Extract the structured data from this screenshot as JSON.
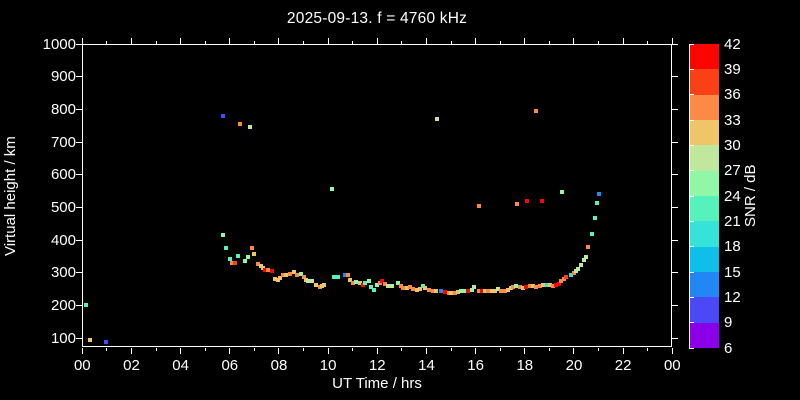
{
  "title": "2025-09-13. f = 4760 kHz",
  "colors": {
    "background": "#000000",
    "foreground": "#ffffff"
  },
  "chart_data": {
    "type": "scatter",
    "title": "2025-09-13. f = 4760 kHz",
    "xlabel": "UT Time / hrs",
    "ylabel": "Virtual height / km",
    "xlim": [
      0,
      24
    ],
    "xtick_hours": [
      0,
      2,
      4,
      6,
      8,
      10,
      12,
      14,
      16,
      18,
      20,
      22,
      24
    ],
    "xtick_labels": [
      "00",
      "02",
      "04",
      "06",
      "08",
      "10",
      "12",
      "14",
      "16",
      "18",
      "20",
      "22",
      "00"
    ],
    "xminor_step_hr": 1,
    "ytick_km": [
      100,
      200,
      300,
      400,
      500,
      600,
      700,
      800,
      900,
      1000
    ],
    "ylim_display": [
      70,
      1000
    ],
    "grid": false,
    "colorbar": {
      "label": "SNR / dB",
      "min": 6,
      "max": 42,
      "step": 3,
      "tick_labels": [
        "42",
        "39",
        "36",
        "33",
        "30",
        "27",
        "24",
        "21",
        "18",
        "15",
        "12",
        "9",
        "6"
      ],
      "colors_low_to_high": [
        "#8A00E9",
        "#4B48F6",
        "#2287F2",
        "#10BFE9",
        "#35E3D9",
        "#55F2BE",
        "#90F7A6",
        "#BFE89D",
        "#F0C468",
        "#FA8A45",
        "#FA4016",
        "#FB0500"
      ]
    },
    "points_format": [
      "ut_hr",
      "virtual_height_km",
      "snr_db"
    ],
    "points": [
      [
        0.15,
        200,
        22.5
      ],
      [
        0.3,
        93,
        31.5
      ],
      [
        0.95,
        88,
        10.5
      ],
      [
        5.71,
        779,
        10.5
      ],
      [
        5.73,
        415,
        25.5
      ],
      [
        5.85,
        374,
        22.5
      ],
      [
        6.0,
        343,
        22.5
      ],
      [
        6.1,
        331,
        34.5
      ],
      [
        6.2,
        329,
        37.5
      ],
      [
        6.32,
        350,
        22.5
      ],
      [
        6.41,
        756,
        34.5
      ],
      [
        6.6,
        335,
        25.5
      ],
      [
        6.75,
        347,
        25.5
      ],
      [
        6.82,
        747,
        28.5
      ],
      [
        6.9,
        376,
        34.5
      ],
      [
        7.0,
        358,
        31.5
      ],
      [
        7.15,
        327,
        34.5
      ],
      [
        7.25,
        320,
        31.5
      ],
      [
        7.35,
        313,
        31.5
      ],
      [
        7.45,
        308,
        40.5
      ],
      [
        7.55,
        307,
        34.5
      ],
      [
        7.7,
        304,
        40.5
      ],
      [
        7.85,
        281,
        31.5
      ],
      [
        7.95,
        278,
        31.5
      ],
      [
        8.05,
        284,
        31.5
      ],
      [
        8.15,
        294,
        34.5
      ],
      [
        8.3,
        294,
        31.5
      ],
      [
        8.45,
        297,
        34.5
      ],
      [
        8.6,
        302,
        31.5
      ],
      [
        8.75,
        294,
        34.5
      ],
      [
        8.9,
        296,
        25.5
      ],
      [
        9.0,
        286,
        34.5
      ],
      [
        9.1,
        279,
        31.5
      ],
      [
        9.2,
        276,
        28.5
      ],
      [
        9.35,
        274,
        28.5
      ],
      [
        9.5,
        261,
        31.5
      ],
      [
        9.65,
        256,
        34.5
      ],
      [
        9.75,
        258,
        31.5
      ],
      [
        9.85,
        263,
        31.5
      ],
      [
        10.14,
        557,
        25.5
      ],
      [
        10.25,
        286,
        22.5
      ],
      [
        10.4,
        286,
        22.5
      ],
      [
        10.7,
        294,
        13.5
      ],
      [
        10.8,
        292,
        34.5
      ],
      [
        10.9,
        279,
        31.5
      ],
      [
        11.0,
        269,
        34.5
      ],
      [
        11.15,
        272,
        25.5
      ],
      [
        11.3,
        269,
        31.5
      ],
      [
        11.4,
        263,
        40.5
      ],
      [
        11.5,
        269,
        22.5
      ],
      [
        11.65,
        276,
        25.5
      ],
      [
        11.75,
        255,
        22.5
      ],
      [
        11.85,
        248,
        22.5
      ],
      [
        12.0,
        261,
        25.5
      ],
      [
        12.1,
        269,
        34.5
      ],
      [
        12.2,
        276,
        40.5
      ],
      [
        12.3,
        266,
        34.5
      ],
      [
        12.45,
        258,
        28.5
      ],
      [
        12.6,
        258,
        28.5
      ],
      [
        12.85,
        269,
        25.5
      ],
      [
        12.95,
        258,
        34.5
      ],
      [
        13.05,
        253,
        34.5
      ],
      [
        13.2,
        253,
        31.5
      ],
      [
        13.35,
        255,
        34.5
      ],
      [
        13.45,
        251,
        34.5
      ],
      [
        13.6,
        248,
        31.5
      ],
      [
        13.75,
        250,
        31.5
      ],
      [
        13.85,
        258,
        22.5
      ],
      [
        13.95,
        253,
        31.5
      ],
      [
        14.1,
        248,
        34.5
      ],
      [
        14.25,
        245,
        34.5
      ],
      [
        14.37,
        245,
        31.5
      ],
      [
        14.42,
        770,
        28.5
      ],
      [
        14.6,
        243,
        13.5
      ],
      [
        14.75,
        241,
        40.5
      ],
      [
        14.9,
        238,
        34.5
      ],
      [
        15.0,
        238,
        31.5
      ],
      [
        15.15,
        238,
        34.5
      ],
      [
        15.3,
        241,
        31.5
      ],
      [
        15.42,
        245,
        25.5
      ],
      [
        15.55,
        245,
        25.5
      ],
      [
        15.7,
        243,
        40.5
      ],
      [
        15.85,
        248,
        25.5
      ],
      [
        15.95,
        255,
        28.5
      ],
      [
        16.13,
        503,
        34.5
      ],
      [
        16.15,
        243,
        34.5
      ],
      [
        16.26,
        243,
        40.5
      ],
      [
        16.4,
        245,
        31.5
      ],
      [
        16.5,
        243,
        34.5
      ],
      [
        16.65,
        245,
        31.5
      ],
      [
        16.78,
        243,
        31.5
      ],
      [
        16.9,
        251,
        28.5
      ],
      [
        17.05,
        245,
        34.5
      ],
      [
        17.18,
        243,
        34.5
      ],
      [
        17.32,
        248,
        31.5
      ],
      [
        17.42,
        253,
        31.5
      ],
      [
        17.52,
        255,
        34.5
      ],
      [
        17.66,
        258,
        25.5
      ],
      [
        17.69,
        510,
        34.5
      ],
      [
        17.79,
        255,
        34.5
      ],
      [
        17.93,
        253,
        31.5
      ],
      [
        18.06,
        255,
        40.5
      ],
      [
        18.07,
        520,
        40.5
      ],
      [
        18.2,
        258,
        34.5
      ],
      [
        18.33,
        258,
        31.5
      ],
      [
        18.44,
        796,
        34.5
      ],
      [
        18.47,
        255,
        34.5
      ],
      [
        18.61,
        258,
        34.5
      ],
      [
        18.71,
        520,
        40.5
      ],
      [
        18.74,
        261,
        31.5
      ],
      [
        18.9,
        261,
        19.5
      ],
      [
        19.01,
        263,
        31.5
      ],
      [
        19.15,
        258,
        34.5
      ],
      [
        19.28,
        261,
        40.5
      ],
      [
        19.39,
        266,
        40.5
      ],
      [
        19.49,
        276,
        34.5
      ],
      [
        19.5,
        547,
        25.5
      ],
      [
        19.58,
        282,
        34.5
      ],
      [
        19.69,
        286,
        37.5
      ],
      [
        19.89,
        292,
        19.5
      ],
      [
        19.99,
        299,
        34.5
      ],
      [
        20.1,
        306,
        28.5
      ],
      [
        20.16,
        312,
        28.5
      ],
      [
        20.3,
        323,
        28.5
      ],
      [
        20.39,
        340,
        28.5
      ],
      [
        20.47,
        347,
        28.5
      ],
      [
        20.57,
        378,
        34.5
      ],
      [
        20.75,
        417,
        22.5
      ],
      [
        20.85,
        468,
        22.5
      ],
      [
        20.93,
        512,
        22.5
      ],
      [
        21.02,
        540,
        13.5
      ]
    ]
  }
}
